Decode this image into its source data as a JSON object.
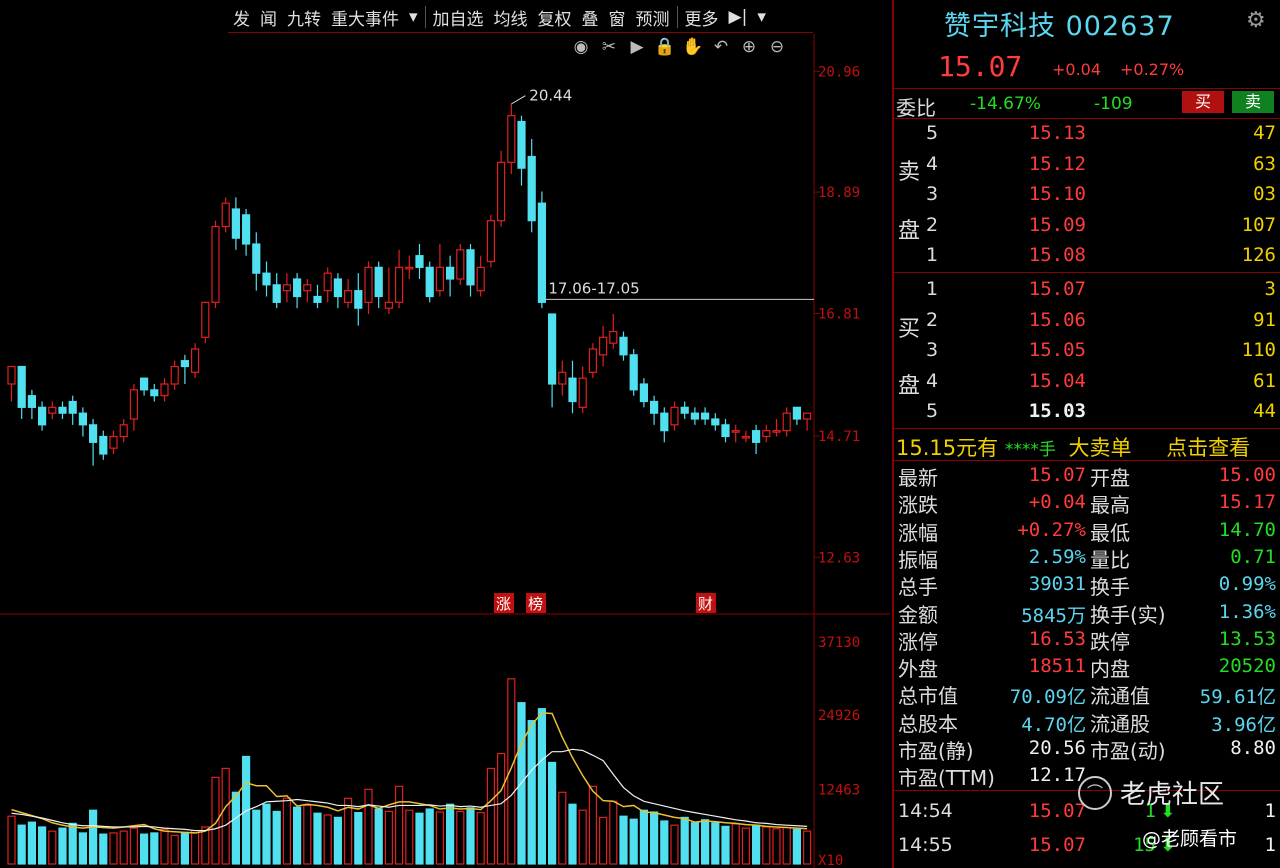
{
  "toolbar": {
    "items": [
      "发",
      "闻",
      "九转",
      "重大事件",
      "▾",
      "加自选",
      "均线",
      "复权",
      "叠",
      "窗",
      "预测",
      "更多",
      "▶|",
      "▾"
    ]
  },
  "tools": [
    "eye-icon",
    "scissors-icon",
    "play-icon",
    "lock-icon",
    "hand-icon",
    "undo-icon",
    "zoom-in-icon",
    "zoom-out-icon"
  ],
  "stock": {
    "name": "赞宇科技",
    "code": "002637",
    "price": "15.07",
    "change": "+0.04",
    "pct": "+0.27%"
  },
  "weibi": {
    "label": "委比",
    "pct": "-14.67%",
    "diff": "-109",
    "buy": "买",
    "sell": "卖"
  },
  "asks": [
    {
      "n": "5",
      "price": "15.13",
      "vol": "47"
    },
    {
      "n": "4",
      "price": "15.12",
      "vol": "63"
    },
    {
      "n": "3",
      "price": "15.10",
      "vol": "03"
    },
    {
      "n": "2",
      "price": "15.09",
      "vol": "107"
    },
    {
      "n": "1",
      "price": "15.08",
      "vol": "126"
    }
  ],
  "bids": [
    {
      "n": "1",
      "price": "15.07",
      "vol": "3"
    },
    {
      "n": "2",
      "price": "15.06",
      "vol": "91"
    },
    {
      "n": "3",
      "price": "15.05",
      "vol": "110"
    },
    {
      "n": "4",
      "price": "15.04",
      "vol": "61"
    },
    {
      "n": "5",
      "price": "15.03",
      "vol": "44"
    }
  ],
  "ask_label": [
    "卖",
    "盘"
  ],
  "bid_label": [
    "买",
    "盘"
  ],
  "promo": {
    "left": "15.15元有",
    "mid": "****手",
    "big": "大卖单",
    "link": "点击查看"
  },
  "stats": [
    {
      "l1": "最新",
      "v1": "15.07",
      "c1": "red",
      "l2": "开盘",
      "v2": "15.00",
      "c2": "red"
    },
    {
      "l1": "涨跌",
      "v1": "+0.04",
      "c1": "red",
      "l2": "最高",
      "v2": "15.17",
      "c2": "red"
    },
    {
      "l1": "涨幅",
      "v1": "+0.27%",
      "c1": "red",
      "l2": "最低",
      "v2": "14.70",
      "c2": "grn"
    },
    {
      "l1": "振幅",
      "v1": "2.59%",
      "c1": "cyan",
      "l2": "量比",
      "v2": "0.71",
      "c2": "grn"
    },
    {
      "l1": "总手",
      "v1": "39031",
      "c1": "cyan",
      "l2": "换手",
      "v2": "0.99%",
      "c2": "cyan"
    },
    {
      "l1": "金额",
      "v1": "5845万",
      "c1": "cyan",
      "l2": "换手(实)",
      "v2": "1.36%",
      "c2": "cyan"
    },
    {
      "l1": "涨停",
      "v1": "16.53",
      "c1": "red",
      "l2": "跌停",
      "v2": "13.53",
      "c2": "grn"
    },
    {
      "l1": "外盘",
      "v1": "18511",
      "c1": "red",
      "l2": "内盘",
      "v2": "20520",
      "c2": "grn"
    },
    {
      "l1": "总市值",
      "v1": "70.09亿",
      "c1": "cyan",
      "l2": "流通值",
      "v2": "59.61亿",
      "c2": "cyan"
    },
    {
      "l1": "总股本",
      "v1": "4.70亿",
      "c1": "cyan",
      "l2": "流通股",
      "v2": "3.96亿",
      "c2": "cyan"
    },
    {
      "l1": "市盈(静)",
      "v1": "20.56",
      "c1": "wht",
      "l2": "市盈(动)",
      "v2": "8.80",
      "c2": "wht"
    },
    {
      "l1": "市盈(TTM)",
      "v1": "12.17",
      "c1": "wht",
      "l2": "",
      "v2": "",
      "c2": "wht"
    }
  ],
  "ticks": [
    {
      "time": "14:54",
      "price": "15.07",
      "vol": "1",
      "dir": "down",
      "count": "1"
    },
    {
      "time": "14:55",
      "price": "15.07",
      "vol": "15",
      "dir": "down",
      "count": "1"
    }
  ],
  "watermark": {
    "brand": "老虎社区",
    "author": "@老顾看市"
  },
  "chart_data": {
    "type": "candlestick",
    "price_axis": [
      "20.96",
      "18.89",
      "16.81",
      "14.71",
      "12.63"
    ],
    "price_range": [
      12.0,
      21.6
    ],
    "volume_axis": [
      "37130",
      "24926",
      "12463",
      "X10"
    ],
    "annotations": {
      "high": "20.44",
      "gap": "17.06-17.05",
      "markers": [
        "涨",
        "榜",
        "财"
      ]
    },
    "candles": [
      [
        15.6,
        15.9,
        15.3,
        15.8
      ],
      [
        15.9,
        15.2,
        15.0,
        15.9
      ],
      [
        15.4,
        15.2,
        15.0,
        15.5
      ],
      [
        15.2,
        14.9,
        14.8,
        15.3
      ],
      [
        15.1,
        15.2,
        15.0,
        15.3
      ],
      [
        15.2,
        15.1,
        15.0,
        15.3
      ],
      [
        15.3,
        15.1,
        14.9,
        15.4
      ],
      [
        15.1,
        14.9,
        14.7,
        15.2
      ],
      [
        14.9,
        14.6,
        14.2,
        15.0
      ],
      [
        14.7,
        14.4,
        14.3,
        14.8
      ],
      [
        14.5,
        14.7,
        14.4,
        14.8
      ],
      [
        14.7,
        14.9,
        14.6,
        15.0
      ],
      [
        15.0,
        15.5,
        14.8,
        15.6
      ],
      [
        15.7,
        15.5,
        15.4,
        15.7
      ],
      [
        15.5,
        15.4,
        15.3,
        15.6
      ],
      [
        15.4,
        15.6,
        15.3,
        15.7
      ],
      [
        15.6,
        15.9,
        15.5,
        16.0
      ],
      [
        16.0,
        15.9,
        15.6,
        16.1
      ],
      [
        15.8,
        16.2,
        15.7,
        16.3
      ],
      [
        16.4,
        17.0,
        16.3,
        17.0
      ],
      [
        17.0,
        18.3,
        16.9,
        18.4
      ],
      [
        18.3,
        18.7,
        18.2,
        18.8
      ],
      [
        18.6,
        18.1,
        17.9,
        18.8
      ],
      [
        18.5,
        18.0,
        17.8,
        18.6
      ],
      [
        18.0,
        17.5,
        17.2,
        18.2
      ],
      [
        17.5,
        17.3,
        17.1,
        17.7
      ],
      [
        17.3,
        17.0,
        16.9,
        17.5
      ],
      [
        17.2,
        17.3,
        17.0,
        17.5
      ],
      [
        17.4,
        17.1,
        16.9,
        17.5
      ],
      [
        17.2,
        17.3,
        17.0,
        17.4
      ],
      [
        17.1,
        17.0,
        16.9,
        17.3
      ],
      [
        17.2,
        17.5,
        17.0,
        17.6
      ],
      [
        17.4,
        17.1,
        16.9,
        17.5
      ],
      [
        17.0,
        17.2,
        16.9,
        17.4
      ],
      [
        17.2,
        16.9,
        16.6,
        17.5
      ],
      [
        17.0,
        17.6,
        16.8,
        17.7
      ],
      [
        17.6,
        17.1,
        16.9,
        17.7
      ],
      [
        16.9,
        17.0,
        16.8,
        17.6
      ],
      [
        17.0,
        17.6,
        16.9,
        17.9
      ],
      [
        17.6,
        17.6,
        17.4,
        17.8
      ],
      [
        17.8,
        17.6,
        17.4,
        18.0
      ],
      [
        17.6,
        17.1,
        17.0,
        17.7
      ],
      [
        17.2,
        17.6,
        17.1,
        18.0
      ],
      [
        17.6,
        17.4,
        17.1,
        17.8
      ],
      [
        17.4,
        17.9,
        17.3,
        18.0
      ],
      [
        17.9,
        17.3,
        17.1,
        18.0
      ],
      [
        17.2,
        17.6,
        17.1,
        17.8
      ],
      [
        17.7,
        18.4,
        17.6,
        18.5
      ],
      [
        18.4,
        19.4,
        18.3,
        19.6
      ],
      [
        19.4,
        20.2,
        19.2,
        20.4
      ],
      [
        20.1,
        19.3,
        19.0,
        20.2
      ],
      [
        19.5,
        18.4,
        18.2,
        19.8
      ],
      [
        18.7,
        17.0,
        16.9,
        18.9
      ],
      [
        16.8,
        15.6,
        15.2,
        16.8
      ],
      [
        15.6,
        15.8,
        15.4,
        16.0
      ],
      [
        15.7,
        15.3,
        15.1,
        16.0
      ],
      [
        15.2,
        15.7,
        15.1,
        15.9
      ],
      [
        15.8,
        16.2,
        15.7,
        16.3
      ],
      [
        16.1,
        16.4,
        15.9,
        16.6
      ],
      [
        16.3,
        16.5,
        16.2,
        16.8
      ],
      [
        16.4,
        16.1,
        16.0,
        16.5
      ],
      [
        16.1,
        15.5,
        15.4,
        16.2
      ],
      [
        15.6,
        15.3,
        15.2,
        15.7
      ],
      [
        15.3,
        15.1,
        14.9,
        15.4
      ],
      [
        15.1,
        14.8,
        14.6,
        15.2
      ],
      [
        14.9,
        15.2,
        14.8,
        15.3
      ],
      [
        15.2,
        15.1,
        15.0,
        15.3
      ],
      [
        15.1,
        15.0,
        14.9,
        15.2
      ],
      [
        15.1,
        15.0,
        14.9,
        15.2
      ],
      [
        15.0,
        14.9,
        14.8,
        15.1
      ],
      [
        14.9,
        14.7,
        14.6,
        15.0
      ],
      [
        14.8,
        14.8,
        14.6,
        14.9
      ],
      [
        14.7,
        14.7,
        14.6,
        14.8
      ],
      [
        14.8,
        14.6,
        14.4,
        14.9
      ],
      [
        14.7,
        14.8,
        14.6,
        14.9
      ],
      [
        14.8,
        14.8,
        14.7,
        15.0
      ],
      [
        14.8,
        15.1,
        14.7,
        15.2
      ],
      [
        15.2,
        15.0,
        14.9,
        15.2
      ],
      [
        15.0,
        15.1,
        14.8,
        15.1
      ]
    ],
    "volumes": [
      8000,
      6500,
      7000,
      6200,
      5500,
      6000,
      6800,
      5200,
      9000,
      5000,
      5200,
      5500,
      6000,
      5000,
      5200,
      5800,
      4800,
      5200,
      5600,
      6200,
      14500,
      16000,
      12000,
      18000,
      9000,
      10000,
      8800,
      11000,
      9500,
      9800,
      8500,
      8200,
      7800,
      11000,
      8600,
      12500,
      9200,
      8800,
      13000,
      9000,
      8500,
      9200,
      8700,
      10000,
      8800,
      9400,
      8600,
      16000,
      18500,
      31000,
      27000,
      24000,
      26000,
      17000,
      12000,
      10000,
      9000,
      13000,
      7800,
      10500,
      8000,
      7500,
      9000,
      8700,
      7200,
      6500,
      7800,
      6900,
      7400,
      6900,
      6300,
      6700,
      6000,
      6500,
      6200,
      5900,
      6100,
      5800,
      5500
    ],
    "ma5_volume": [
      9100,
      8600,
      8100,
      7600,
      6900,
      6500,
      6200,
      6000,
      6200,
      6100,
      6000,
      6200,
      6400,
      6600,
      5900,
      5500,
      5400,
      5300,
      5200,
      5500,
      6800,
      9600,
      11400,
      13600,
      13100,
      13100,
      11300,
      11400,
      9700,
      10000,
      9800,
      9500,
      8900,
      9500,
      9200,
      9900,
      9300,
      9900,
      10400,
      10400,
      10100,
      9800,
      9200,
      9400,
      9200,
      9300,
      9100,
      10600,
      12300,
      16100,
      20200,
      23300,
      25300,
      25200,
      21200,
      17800,
      14800,
      12200,
      10600,
      10500,
      9600,
      9800,
      8700,
      8600,
      8200,
      7800,
      7600,
      7000,
      7200,
      7100,
      6900,
      6800,
      6600,
      6500,
      6300,
      6200,
      6100,
      6000,
      5900
    ],
    "ma10_volume": [
      8500,
      8300,
      8000,
      7700,
      7300,
      6900,
      6600,
      6400,
      6400,
      6300,
      6200,
      6200,
      6200,
      6300,
      6200,
      6000,
      5900,
      5800,
      5600,
      5600,
      5900,
      6500,
      7700,
      8900,
      9600,
      10400,
      10500,
      10600,
      10800,
      10600,
      10400,
      10200,
      9800,
      9800,
      9600,
      9900,
      9700,
      9500,
      9800,
      9800,
      9800,
      9900,
      9700,
      9800,
      9600,
      9700,
      9500,
      9800,
      10100,
      11500,
      13600,
      15700,
      17400,
      18800,
      18800,
      19200,
      19000,
      18200,
      17300,
      15000,
      12800,
      11400,
      10500,
      10100,
      9700,
      9300,
      8900,
      8600,
      8300,
      8000,
      7700,
      7400,
      7200,
      6900,
      6800,
      6600,
      6500,
      6400,
      6300
    ]
  }
}
